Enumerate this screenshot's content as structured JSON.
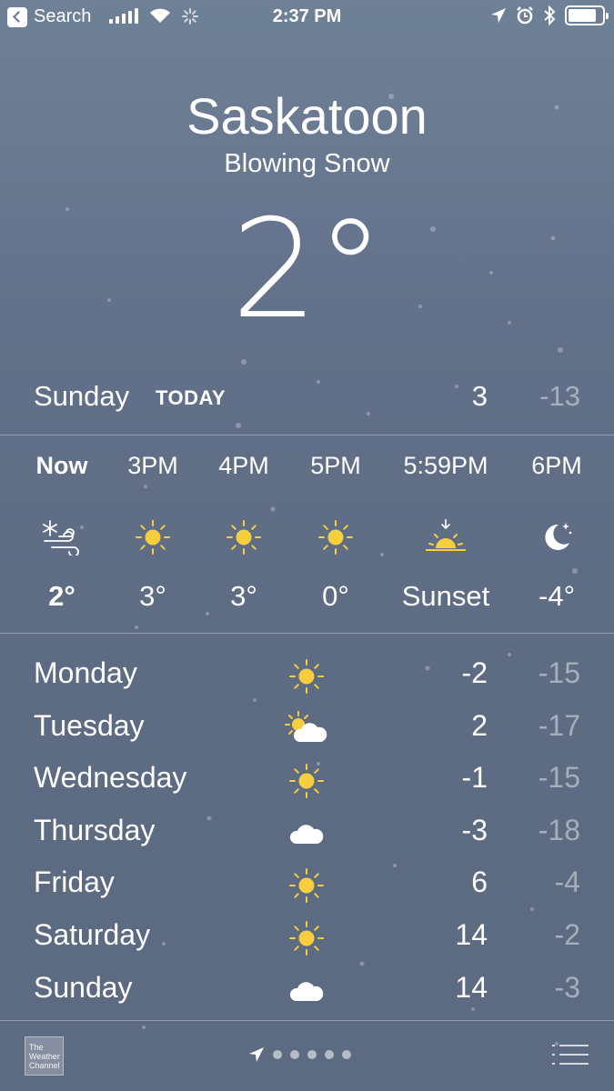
{
  "status_bar": {
    "back_label": "Search",
    "time": "2:37 PM"
  },
  "header": {
    "city": "Saskatoon",
    "condition": "Blowing Snow",
    "temperature": "2°"
  },
  "today": {
    "day": "Sunday",
    "tag": "TODAY",
    "high": "3",
    "low": "-13"
  },
  "hourly": [
    {
      "time": "Now",
      "icon": "blowing-snow-icon",
      "value": "2°"
    },
    {
      "time": "3PM",
      "icon": "sun-icon",
      "value": "3°"
    },
    {
      "time": "4PM",
      "icon": "sun-icon",
      "value": "3°"
    },
    {
      "time": "5PM",
      "icon": "sun-icon",
      "value": "0°"
    },
    {
      "time": "5:59PM",
      "icon": "sunset-icon",
      "value": "Sunset"
    },
    {
      "time": "6PM",
      "icon": "moon-icon",
      "value": "-4°"
    }
  ],
  "daily": [
    {
      "day": "Monday",
      "icon": "sun-icon",
      "high": "-2",
      "low": "-15"
    },
    {
      "day": "Tuesday",
      "icon": "partly-cloudy-icon",
      "high": "2",
      "low": "-17"
    },
    {
      "day": "Wednesday",
      "icon": "sun-icon",
      "high": "-1",
      "low": "-15"
    },
    {
      "day": "Thursday",
      "icon": "cloud-icon",
      "high": "-3",
      "low": "-18"
    },
    {
      "day": "Friday",
      "icon": "sun-icon",
      "high": "6",
      "low": "-4"
    },
    {
      "day": "Saturday",
      "icon": "sun-icon",
      "high": "14",
      "low": "-2"
    },
    {
      "day": "Sunday",
      "icon": "cloud-icon",
      "high": "14",
      "low": "-3"
    }
  ],
  "footer": {
    "weather_channel_logo": "The Weather Channel",
    "page_count": 5
  },
  "colors": {
    "sun": "#f7cf3e",
    "background_top": "#6f8197",
    "background_bottom": "#5c6a82"
  }
}
